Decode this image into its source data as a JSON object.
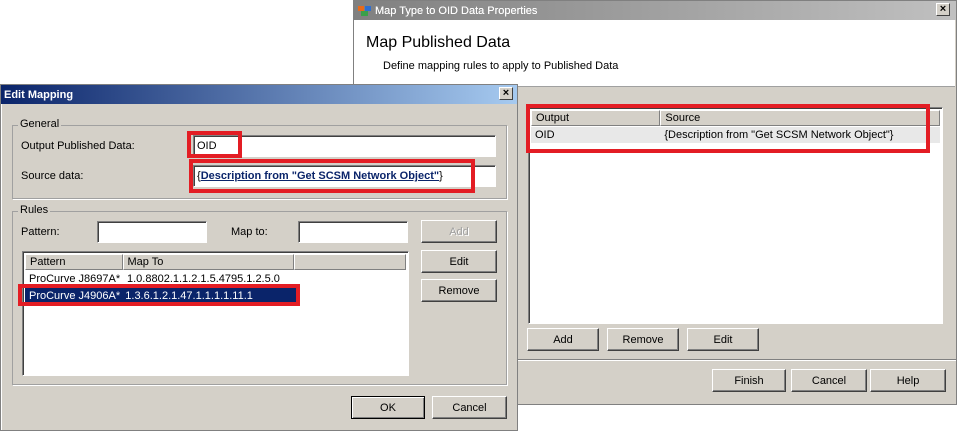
{
  "back_window": {
    "title": "Map Type to OID Data Properties",
    "heading": "Map Published Data",
    "subheading": "Define mapping rules to apply to Published Data",
    "columns": [
      "Output",
      "Source"
    ],
    "rows": [
      {
        "output": "OID",
        "source": "{Description from \"Get SCSM Network  Object\"}"
      }
    ],
    "buttons": {
      "add": "Add",
      "remove": "Remove",
      "edit": "Edit",
      "finish": "Finish",
      "cancel": "Cancel",
      "help": "Help"
    },
    "close_glyph": "×"
  },
  "edit_window": {
    "title": "Edit Mapping",
    "close_glyph": "×",
    "general": {
      "legend": "General",
      "output_label": "Output Published Data:",
      "output_value": "OID",
      "source_label": "Source data:",
      "source_open": "{",
      "source_link": "Description from \"Get SCSM Network  Object\"",
      "source_close": "}"
    },
    "rules": {
      "legend": "Rules",
      "pattern_label": "Pattern:",
      "pattern_value": "",
      "mapto_label": "Map to:",
      "mapto_value": "",
      "columns": [
        "Pattern",
        "Map To"
      ],
      "rows": [
        {
          "pattern": "ProCurve J8697A*",
          "map_to": "1.0.8802.1.1.2.1.5.4795.1.2.5.0"
        },
        {
          "pattern": "ProCurve J4906A*",
          "map_to": "1.3.6.1.2.1.47.1.1.1.1.11.1"
        }
      ],
      "buttons": {
        "add": "Add",
        "edit": "Edit",
        "remove": "Remove"
      }
    },
    "buttons": {
      "ok": "OK",
      "cancel": "Cancel"
    }
  },
  "colors": {
    "highlight": "#e31d24",
    "selection": "#0a246a",
    "titlebar_active": "#0a246a",
    "window": "#d4d0c8"
  }
}
